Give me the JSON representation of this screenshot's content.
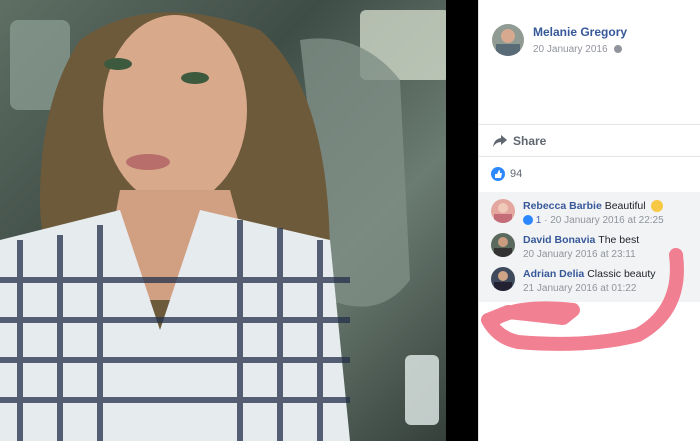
{
  "post": {
    "author": "Melanie Gregory",
    "date": "20 January 2016",
    "privacy_icon": "globe-icon"
  },
  "actions": {
    "share_label": "Share"
  },
  "reactions": {
    "count": "94",
    "icon": "like-icon"
  },
  "comments": [
    {
      "name": "Rebecca Barbie",
      "text": "Beautiful",
      "reply_count": "1",
      "meta": "20 January 2016 at 22:25"
    },
    {
      "name": "David Bonavia",
      "text": "The best",
      "meta": "20 January 2016 at 23:11"
    },
    {
      "name": "Adrian Delia",
      "text": "Classic beauty",
      "meta": "21 January 2016 at 01:22"
    }
  ],
  "colors": {
    "link_blue": "#365899",
    "meta_gray": "#90949c",
    "highlight_marker": "#f06a80"
  }
}
